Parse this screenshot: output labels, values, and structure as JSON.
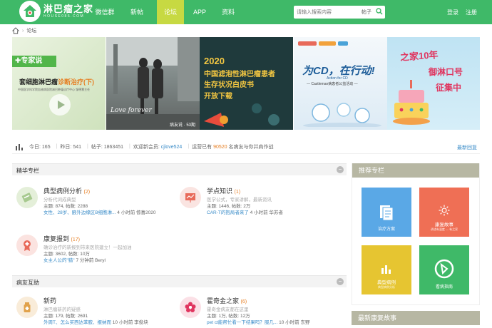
{
  "header": {
    "logo_text": "淋巴瘤之家",
    "logo_sub": "HOUSE086.COM",
    "nav": [
      "微信群",
      "新帖",
      "论坛",
      "APP",
      "资料"
    ],
    "active_nav": "论坛",
    "search_placeholder": "请输入搜索内容",
    "search_type": "帖子",
    "login": "登录",
    "register": "注册",
    "colors": {
      "header": "#3fb968",
      "active_tab": "#c7d942"
    }
  },
  "breadcrumb": {
    "home_icon": "home-icon",
    "current": "论坛"
  },
  "banners": [
    {
      "tag": "专家说",
      "title": "套细胞淋巴瘤",
      "highlight": "诊断治疗(下)",
      "caption": "中国医学科学院血液病医院淋巴肿瘤诊疗中心   邹德慧主任"
    },
    {
      "caption": "病友说 · 53期",
      "quote": "Love forever"
    },
    {
      "year": "2020",
      "line1": "中国滤泡性淋巴瘤患者",
      "line2": "生存状况白皮书",
      "line3": "开放下载"
    },
    {
      "title": "为CD，在行动!",
      "subtitle": "Action for CD",
      "caption": "— Castleman病患者公益活动 —"
    },
    {
      "title": "之家10年",
      "line1": "御淋口号",
      "line2": "征集中"
    }
  ],
  "stats": {
    "today_label": "今日:",
    "today": "165",
    "yesterday_label": "昨日:",
    "yesterday": "541",
    "posts_label": "帖子:",
    "posts": "1863451",
    "welcome_label": "欢迎新会员:",
    "new_member": "cjlove524",
    "running_prefix": "运营已有",
    "running_days": "90520",
    "running_suffix": "名病友与你并肩作战",
    "latest": "最新回复"
  },
  "sections": {
    "featured": "精华专栏",
    "mutual": "病友互助"
  },
  "categories": [
    {
      "name": "典型病例分析",
      "count": "(2)",
      "desc": "分析代词成典型",
      "stats": "主题: 874, 帖数: 2288",
      "last_link": "女性、28岁、腋外边缘区B细胞淋...",
      "last_meta": "4 小时前 惊喜2020"
    },
    {
      "name": "学点知识",
      "count": "(1)",
      "desc": "医学公式，专家讲解，最新资讯",
      "stats": "主题: 1446, 帖数: 2万",
      "last_link": "CAR-T的抱局者来了",
      "last_meta": "4 小时前 华苏者"
    },
    {
      "name": "康复报到",
      "count": "(17)",
      "desc": "确诊治疗的新报到带来医院建立！一起加油",
      "stats": "主题: 3602, 帖数: 10万",
      "last_link": "女主人公的\"猎\"",
      "last_meta": "7 分钟前 Beryl"
    },
    {
      "name": "新药",
      "count": "",
      "desc": "淋巴瘤新药的疑惑",
      "stats": "主题: 179, 帖数: 2691",
      "last_link": "外周T、怎么买西达苯胺、报纳而",
      "last_meta": "10 小时前 李俊块"
    },
    {
      "name": "霍奇金之家",
      "count": "(6)",
      "desc": "霍奇金病友都在这里",
      "stats": "主题: 1万, 帖数: 12万",
      "last_link": "pet ct能帮忙看一下结果吗？服几...",
      "last_meta": "10 小时前 东野"
    }
  ],
  "sidebar": {
    "recommend_title": "推荐专栏",
    "tiles": [
      {
        "label": "治疗方案",
        "color": "#5aa8e6",
        "icon": "document-icon"
      },
      {
        "label": "康复故事",
        "sub": "讲述有温度 — 有之家",
        "color": "#ef6f55",
        "icon": "sun-icon"
      },
      {
        "label": "典型病例",
        "sub": "典型病例分析",
        "color": "#e6c531",
        "icon": "chart-icon"
      },
      {
        "label": "看病指南",
        "color": "#3fb968",
        "icon": "compass-icon"
      }
    ],
    "stories_title": "最新康复故事"
  }
}
